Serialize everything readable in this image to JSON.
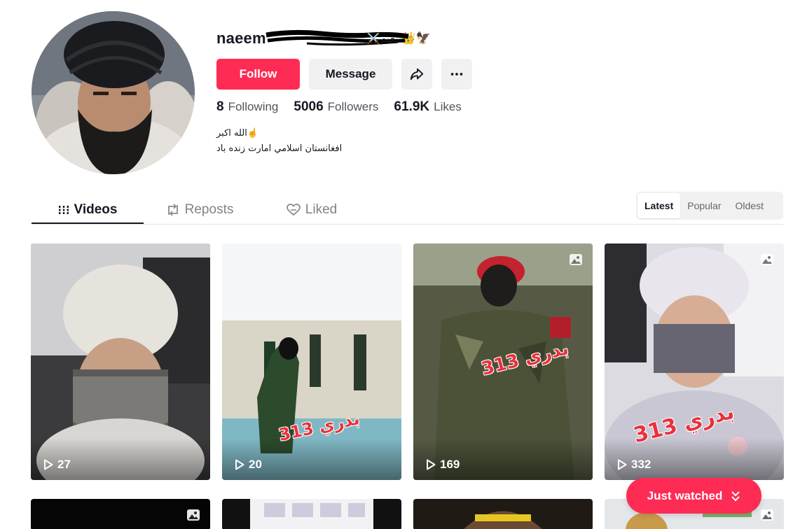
{
  "profile": {
    "username": "naeem",
    "display_name_extra": "⚔️نعیم",
    "emoji_suffix": "👑🦅",
    "bio_lines": [
      "☝️الله اکبر",
      "افغانستان اسلامي امارت زنده باد"
    ]
  },
  "actions": {
    "follow_label": "Follow",
    "message_label": "Message",
    "share_icon": "share-icon",
    "more_icon": "more-icon"
  },
  "stats": [
    {
      "value": "8",
      "label": "Following"
    },
    {
      "value": "5006",
      "label": "Followers"
    },
    {
      "value": "61.9K",
      "label": "Likes"
    }
  ],
  "tabs": [
    {
      "label": "Videos",
      "icon": "grid-icon",
      "active": true
    },
    {
      "label": "Reposts",
      "icon": "repost-icon",
      "active": false
    },
    {
      "label": "Liked",
      "icon": "liked-heart-icon",
      "active": false
    }
  ],
  "sort": {
    "options": [
      "Latest",
      "Popular",
      "Oldest"
    ],
    "selected": "Latest"
  },
  "videos": [
    {
      "views": "27",
      "is_photo": false
    },
    {
      "views": "20",
      "is_photo": false,
      "caption": "313 بدري"
    },
    {
      "views": "169",
      "is_photo": true,
      "caption": "313 بدري"
    },
    {
      "views": "332",
      "is_photo": true,
      "caption": "313 بدري"
    }
  ],
  "videos_row2": [
    {
      "is_photo": true
    },
    {
      "is_photo": false
    },
    {
      "is_photo": false
    },
    {
      "is_photo": true
    }
  ],
  "just_watched_label": "Just watched",
  "colors": {
    "brand": "#fe2c55",
    "button_gray": "#f1f1f2",
    "text": "#161823"
  }
}
